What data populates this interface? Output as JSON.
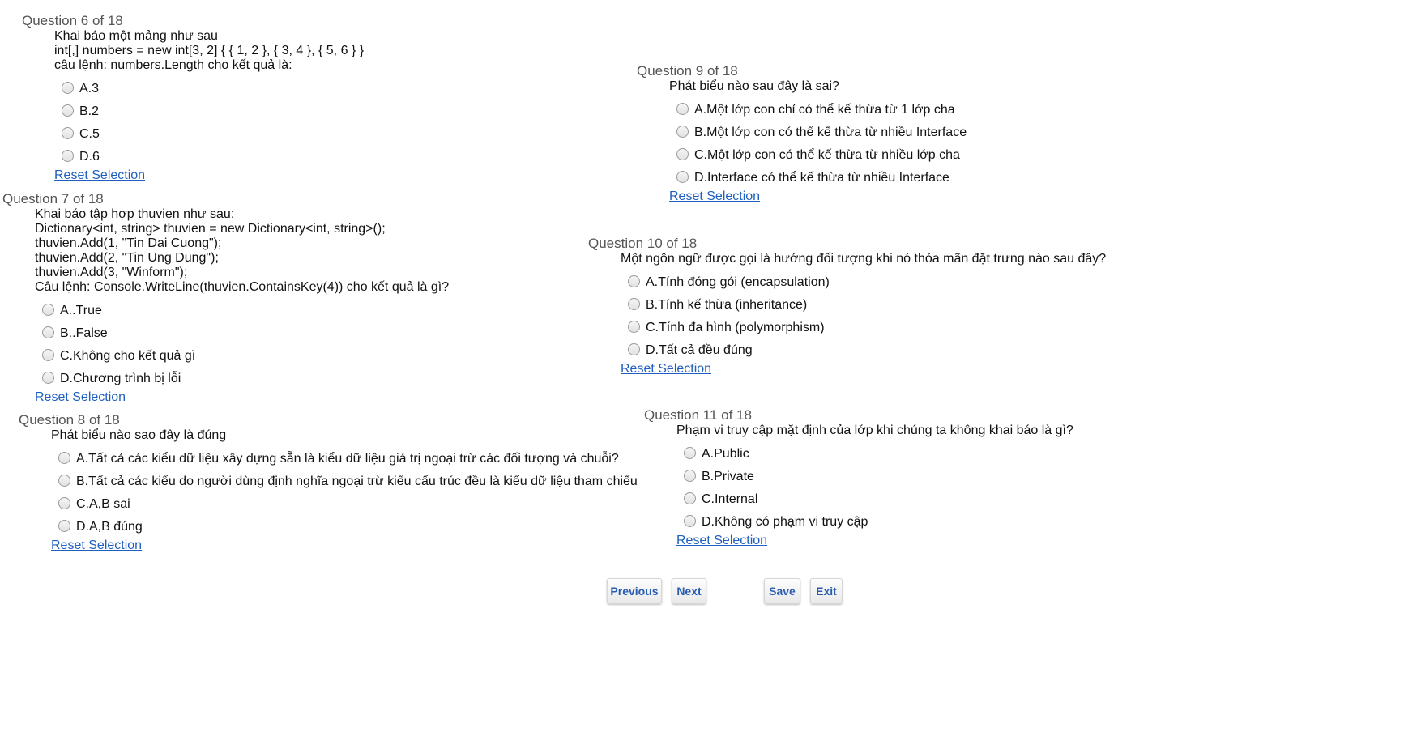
{
  "questions": [
    {
      "header": "Question 6 of 18",
      "lines": [
        "Khai báo một mảng như sau",
        "int[,] numbers = new int[3, 2] { { 1, 2 }, { 3, 4 }, { 5, 6 } }",
        "câu lệnh: numbers.Length cho kết quả là:"
      ],
      "options": [
        "A.3",
        "B.2",
        "C.5",
        "D.6"
      ],
      "reset_label": "Reset Selection"
    },
    {
      "header": "Question 7 of 18",
      "lines": [
        "Khai báo tập hợp thuvien như sau:",
        "Dictionary<int, string> thuvien = new Dictionary<int, string>();",
        "thuvien.Add(1, \"Tin Dai Cuong\");",
        "thuvien.Add(2, \"Tin Ung Dung\");",
        "thuvien.Add(3, \"Winform\");",
        "Câu lệnh: Console.WriteLine(thuvien.ContainsKey(4)) cho kết quả là gì?"
      ],
      "options": [
        "A..True",
        "B..False",
        "C.Không cho kết quả gì",
        "D.Chương trình bị lỗi"
      ],
      "reset_label": "Reset Selection"
    },
    {
      "header": "Question 8 of 18",
      "lines": [
        "Phát biểu nào sao đây là đúng"
      ],
      "options": [
        "A.Tất cả các kiểu dữ liệu xây dựng sẵn là kiểu dữ liệu giá trị ngoại trừ các đối tượng và chuỗi?",
        "B.Tất cả các kiểu do người dùng định nghĩa ngoại trừ kiểu cấu trúc đều là kiểu dữ liệu tham chiếu",
        "C.A,B sai",
        "D.A,B đúng"
      ],
      "reset_label": "Reset Selection"
    },
    {
      "header": "Question 9 of 18",
      "lines": [
        "Phát biểu nào sau đây là sai?"
      ],
      "options": [
        "A.Một lớp con chỉ có thể kế thừa từ 1 lớp cha",
        "B.Một lớp con có thể kế thừa từ nhiều Interface",
        "C.Một lớp con có thể kế thừa từ nhiều lớp cha",
        "D.Interface có thể kế thừa từ nhiều Interface"
      ],
      "reset_label": "Reset Selection"
    },
    {
      "header": "Question 10 of 18",
      "lines": [
        "Một ngôn ngữ được gọi là hướng đối tượng khi nó thỏa mãn đặt trưng nào sau đây?"
      ],
      "options": [
        "A.Tính đóng gói (encapsulation)",
        "B.Tính kế thừa (inheritance)",
        "C.Tính đa hình (polymorphism)",
        "D.Tất cả đều đúng"
      ],
      "reset_label": "Reset Selection"
    },
    {
      "header": "Question 11 of 18",
      "lines": [
        "Phạm vi truy cập mặt định của lớp khi chúng ta không khai báo là gì?"
      ],
      "options": [
        "A.Public",
        "B.Private",
        "C.Internal",
        "D.Không có phạm vi truy cập"
      ],
      "reset_label": "Reset Selection"
    }
  ],
  "buttons": {
    "previous": "Previous",
    "next": "Next",
    "save": "Save",
    "exit": "Exit"
  },
  "colors": {
    "link": "#1f5fbf",
    "button_text": "#2a5db0",
    "header_text": "#555555"
  }
}
